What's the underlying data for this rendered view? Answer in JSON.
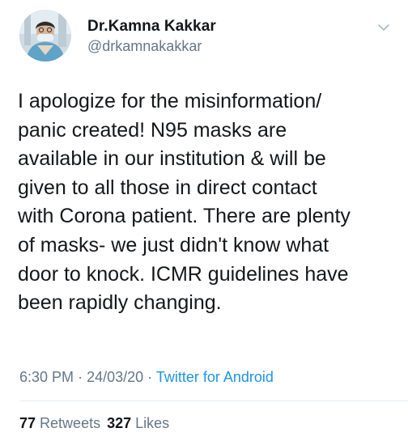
{
  "author": {
    "display_name": "Dr.Kamna Kakkar",
    "handle": "@drkamnakakkar",
    "avatar_icon": "profile-photo"
  },
  "menu": {
    "icon": "chevron-down-icon"
  },
  "tweet": {
    "text": "I apologize for the misinformation/\npanic created! N95 masks are\navailable in our institution & will be\ngiven to all those in direct contact\nwith Corona patient. There are plenty\nof masks- we just didn't know what\ndoor to knock. ICMR guidelines have\nbeen rapidly changing.",
    "time": "6:30 PM",
    "separator": "·",
    "date": "24/03/20",
    "source": "Twitter for Android"
  },
  "stats": {
    "retweets_count": "77",
    "retweets_label": "Retweets",
    "likes_count": "327",
    "likes_label": "Likes"
  },
  "colors": {
    "text": "#14171a",
    "secondary": "#657786",
    "link": "#1b95e0",
    "divider": "#e6ecf0"
  }
}
